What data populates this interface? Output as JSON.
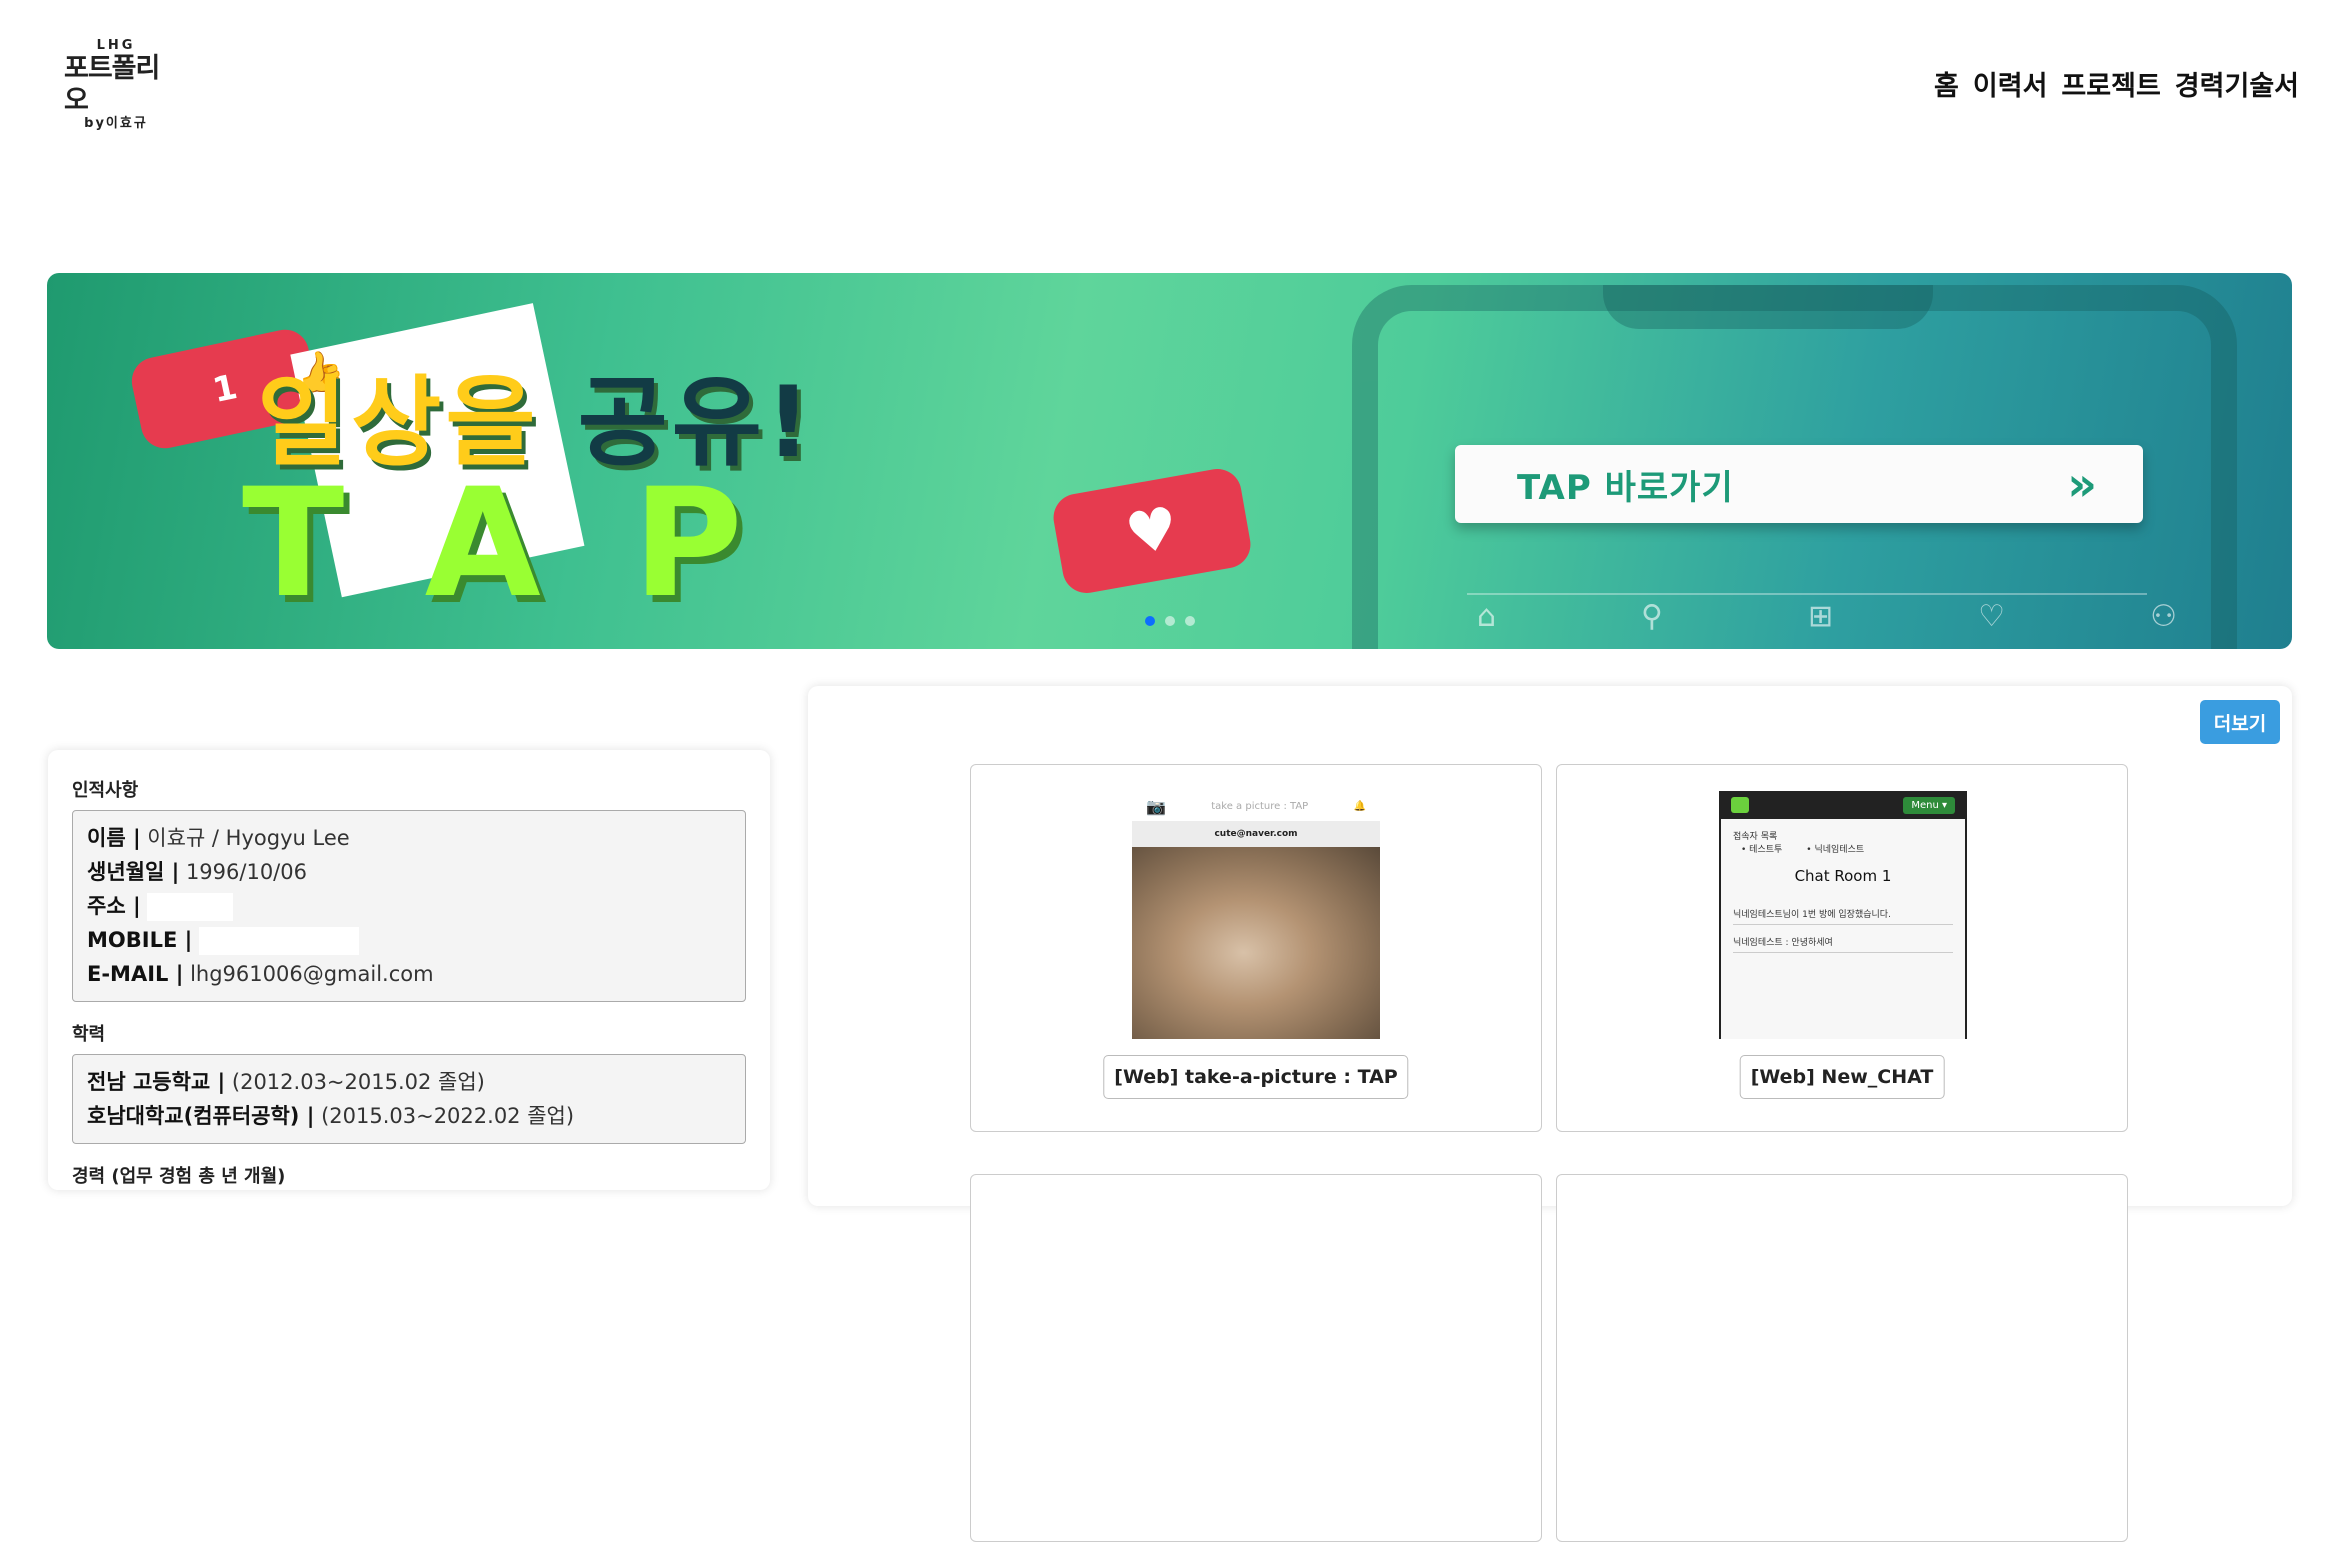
{
  "header": {
    "logo": {
      "top": "LHG",
      "main": "포트폴리오",
      "bottom": "by이효규"
    },
    "nav": [
      "홈",
      "이력서",
      "프로젝트",
      "경력기술서"
    ]
  },
  "banner": {
    "heading_yellow": "일상을",
    "heading_dark": "공유!",
    "big_text": "TAP",
    "like_count": "1",
    "button_label": "TAP 바로가기",
    "button_arrow": "»",
    "slide_count": 3,
    "active_slide": 1
  },
  "profile": {
    "personal_title": "인적사항",
    "name_label": "이름 |",
    "name_value": " 이효규 / Hyogyu Lee",
    "birth_label": "생년월일 |",
    "birth_value": " 1996/10/06",
    "address_label": "주소 |",
    "mobile_label": "MOBILE |",
    "email_label": "E-MAIL |",
    "email_value": " lhg961006@gmail.com",
    "education_title": "학력",
    "edu1_label": "전남 고등학교 |",
    "edu1_value": " (2012.03~2015.02 졸업)",
    "edu2_label": "호남대학교(컴퓨터공학) |",
    "edu2_value": " (2015.03~2022.02 졸업)",
    "career_title": "경력 (업무 경험 총  년   개월)"
  },
  "projects": {
    "more_label": "더보기",
    "items": [
      {
        "label": "[Web] take-a-picture : TAP",
        "thumb_title": "take a picture : TAP",
        "thumb_user": "cute@naver.com"
      },
      {
        "label": "[Web] New_CHAT",
        "thumb_menu": "Menu ▾",
        "thumb_users_title": "접속자 목록",
        "thumb_user1": "• 테스트투",
        "thumb_user2": "• 닉네임테스트",
        "thumb_room": "Chat Room 1",
        "thumb_msg1": "닉네임테스트님이 1번 방에 입장했습니다.",
        "thumb_msg2": "닉네임테스트 : 안녕하세여"
      }
    ]
  }
}
